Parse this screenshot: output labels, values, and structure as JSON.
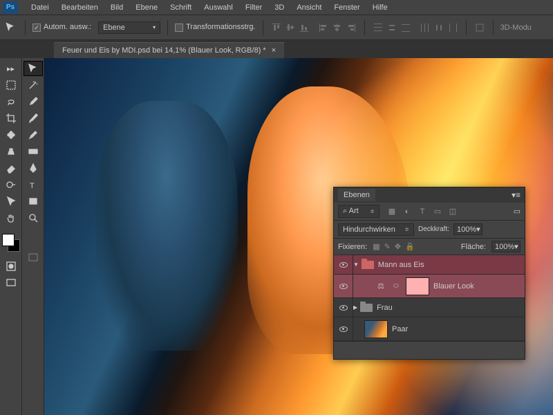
{
  "app": {
    "logo": "Ps"
  },
  "menu": [
    "Datei",
    "Bearbeiten",
    "Bild",
    "Ebene",
    "Schrift",
    "Auswahl",
    "Filter",
    "3D",
    "Ansicht",
    "Fenster",
    "Hilfe"
  ],
  "options": {
    "auto_select": "Autom. ausw.:",
    "target": "Ebene",
    "transform": "Transformationsstrg.",
    "mode3d": "3D-Modu"
  },
  "doc": {
    "title": "Feuer und Eis by MDI.psd bei 14,1% (Blauer Look, RGB/8) *"
  },
  "layers_panel": {
    "title": "Ebenen",
    "filter_label": "Art",
    "filter_icon": "⌕",
    "blend_mode": "Hindurchwirken",
    "opacity_label": "Deckkraft:",
    "opacity_value": "100%",
    "lock_label": "Fixieren:",
    "fill_label": "Fläche:",
    "fill_value": "100%",
    "layers": [
      {
        "name": "Mann aus Eis"
      },
      {
        "name": "Blauer Look"
      },
      {
        "name": "Frau"
      },
      {
        "name": "Paar"
      }
    ]
  }
}
